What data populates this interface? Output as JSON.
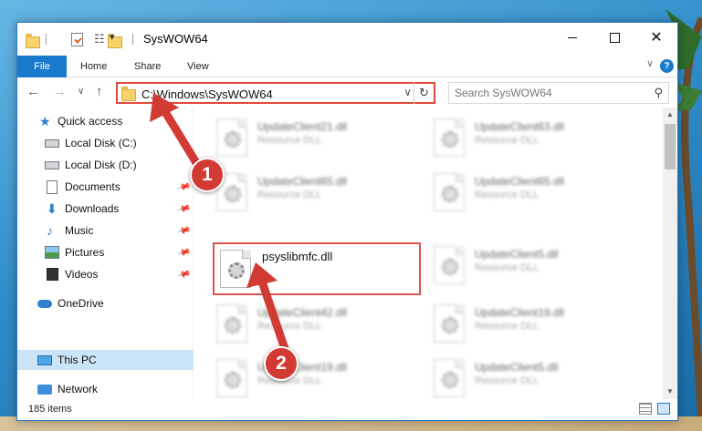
{
  "window": {
    "title": "SysWOW64",
    "quick_access_dropdown": "▾",
    "min_label": "",
    "max_label": "",
    "close_label": "✕"
  },
  "ribbon": {
    "tabs": [
      "File",
      "Home",
      "Share",
      "View"
    ],
    "help": "?",
    "collapse": "∨"
  },
  "navigation": {
    "back": "←",
    "forward": "→",
    "recent": "∨",
    "up": "↑",
    "address_path": "C:\\Windows\\SysWOW64",
    "address_dropdown": "∨",
    "refresh": "↻",
    "search_placeholder": "Search SysWOW64",
    "search_icon": "⚲"
  },
  "sidebar": {
    "items": [
      {
        "label": "Quick access",
        "icon": "star-icon"
      },
      {
        "label": "Local Disk (C:)",
        "icon": "drive-icon"
      },
      {
        "label": "Local Disk (D:)",
        "icon": "drive-icon"
      },
      {
        "label": "Documents",
        "icon": "documents-icon",
        "pinned": true
      },
      {
        "label": "Downloads",
        "icon": "downloads-icon",
        "pinned": true
      },
      {
        "label": "Music",
        "icon": "music-icon",
        "pinned": true
      },
      {
        "label": "Pictures",
        "icon": "pictures-icon",
        "pinned": true
      },
      {
        "label": "Videos",
        "icon": "videos-icon",
        "pinned": true
      },
      {
        "label": "OneDrive",
        "icon": "onedrive-icon"
      },
      {
        "label": "This PC",
        "icon": "this-pc-icon",
        "selected": true
      },
      {
        "label": "Network",
        "icon": "network-icon"
      }
    ],
    "pin_glyph": "📌"
  },
  "files": [
    {
      "name": "UpdateClient21.dll",
      "type": "Resource DLL"
    },
    {
      "name": "UpdateClient63.dll",
      "type": "Resource DLL"
    },
    {
      "name": "UpdateClient65.dll",
      "type": "Resource DLL"
    },
    {
      "name": "UpdateClient65.dll",
      "type": "Resource DLL"
    },
    {
      "name": "psyslibmfc.dll",
      "type": ""
    },
    {
      "name": "UpdateClient5.dll",
      "type": "Resource DLL"
    },
    {
      "name": "UpdateClient42.dll",
      "type": "Resource DLL"
    },
    {
      "name": "UpdateClient19.dll",
      "type": "Resource DLL"
    },
    {
      "name": "UpdateClient19.dll",
      "type": "Resource DLL"
    },
    {
      "name": "UpdateClient5.dll",
      "type": "Resource DLL"
    }
  ],
  "status": {
    "item_count": "185 items"
  },
  "annotations": {
    "step1": "1",
    "step2": "2",
    "highlight_color": "#d23a34"
  }
}
